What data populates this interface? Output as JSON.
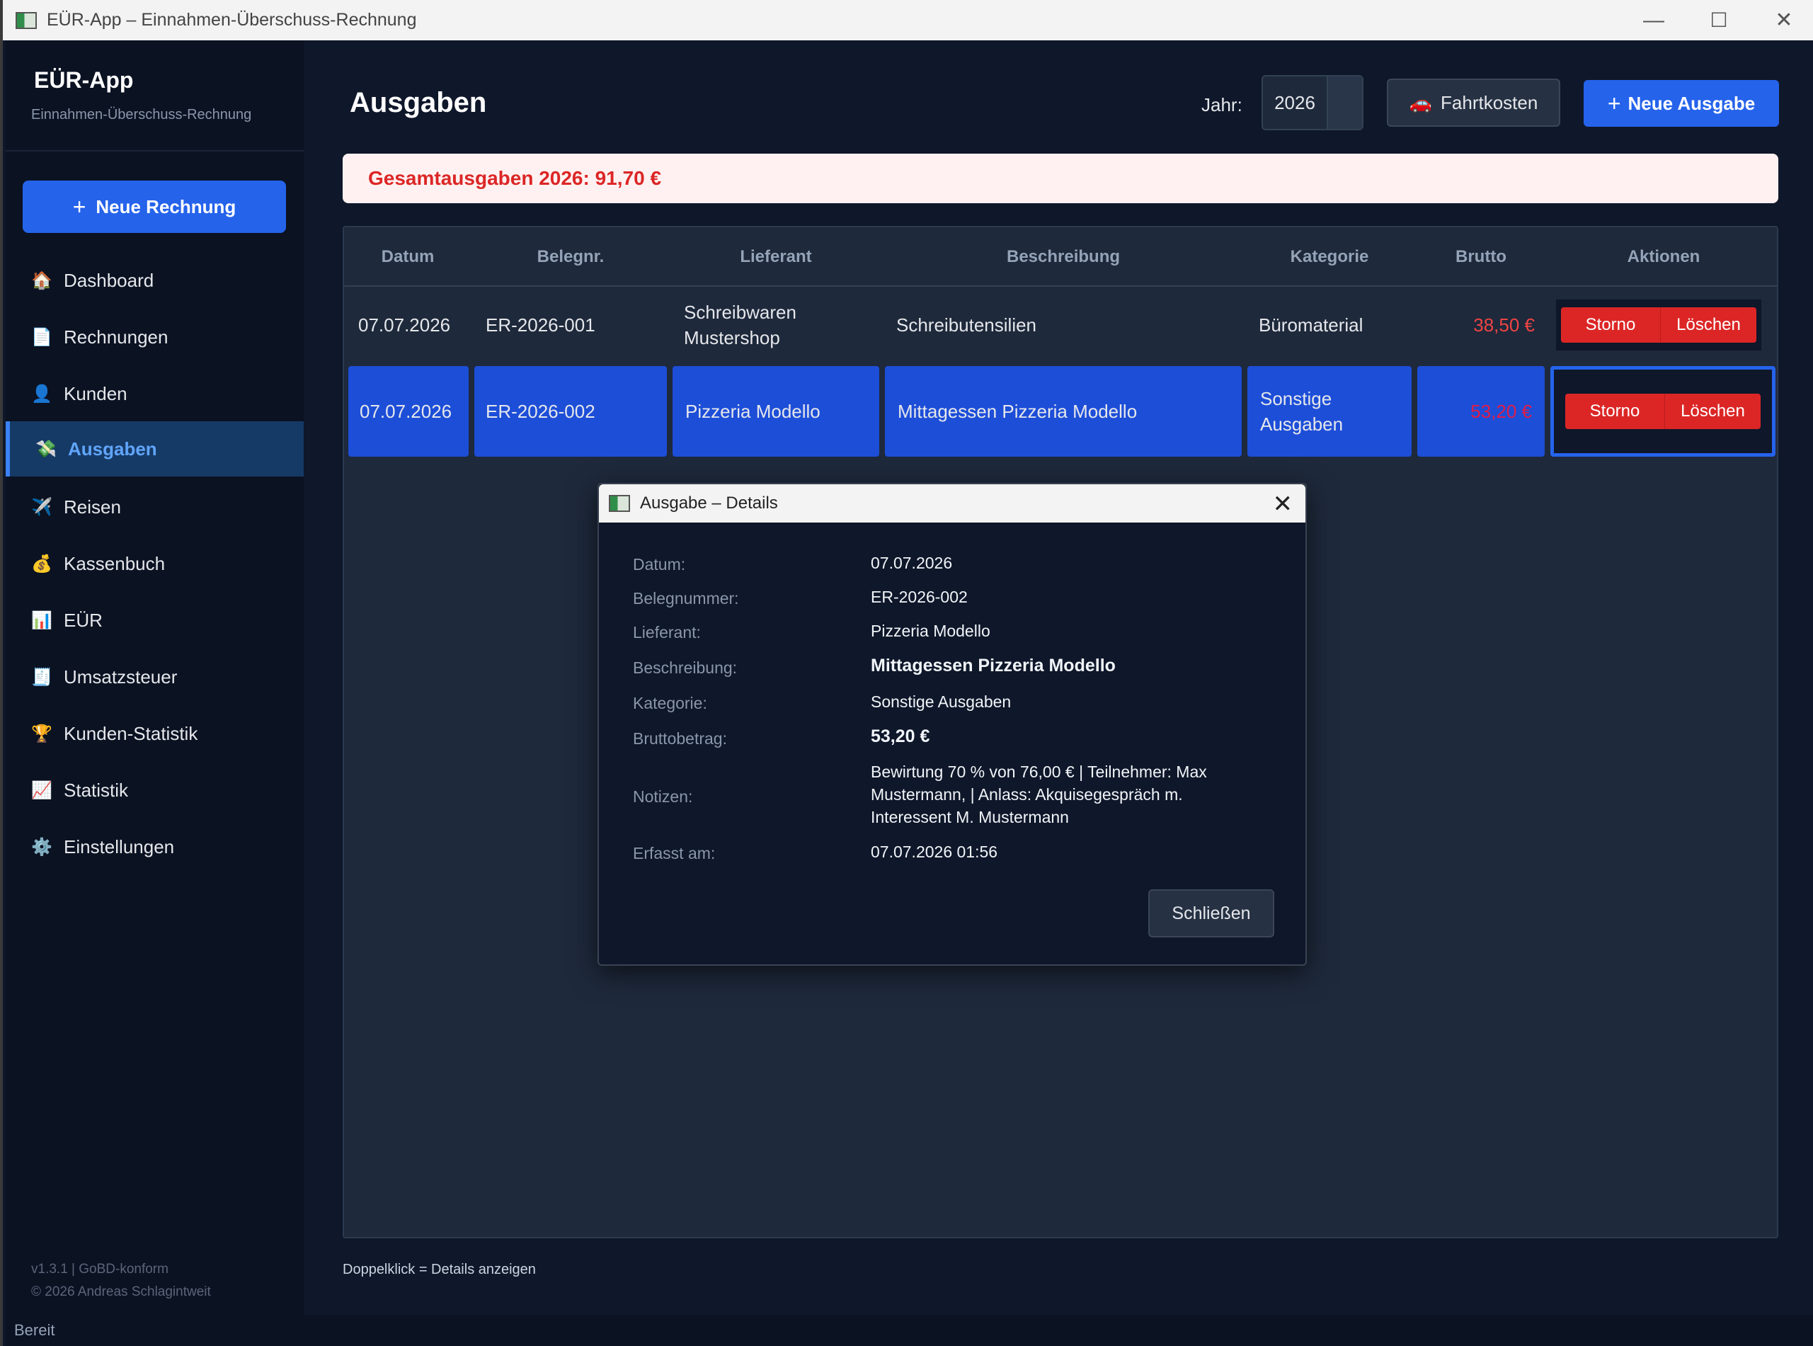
{
  "window": {
    "title": "EÜR-App – Einnahmen-Überschuss-Rechnung",
    "controls": {
      "minimize": "—",
      "maximize": "☐",
      "close": "✕"
    }
  },
  "sidebar": {
    "brand": "EÜR-App",
    "subtitle": "Einnahmen-Überschuss-Rechnung",
    "new_invoice": {
      "icon": "+",
      "label": "Neue Rechnung"
    },
    "items": [
      {
        "icon": "🏠",
        "icon_name": "house-icon",
        "label": "Dashboard"
      },
      {
        "icon": "📄",
        "icon_name": "document-icon",
        "label": "Rechnungen"
      },
      {
        "icon": "👤",
        "icon_name": "user-icon",
        "label": "Kunden"
      },
      {
        "icon": "💸",
        "icon_name": "money-wings-icon",
        "label": "Ausgaben",
        "active": true
      },
      {
        "icon": "✈️",
        "icon_name": "airplane-icon",
        "label": "Reisen"
      },
      {
        "icon": "💰",
        "icon_name": "money-bag-icon",
        "label": "Kassenbuch"
      },
      {
        "icon": "📊",
        "icon_name": "bar-chart-icon",
        "label": "EÜR"
      },
      {
        "icon": "🧾",
        "icon_name": "receipt-icon",
        "label": "Umsatzsteuer"
      },
      {
        "icon": "🏆",
        "icon_name": "trophy-icon",
        "label": "Kunden-Statistik"
      },
      {
        "icon": "📈",
        "icon_name": "line-chart-icon",
        "label": "Statistik"
      },
      {
        "icon": "⚙️",
        "icon_name": "gear-icon",
        "label": "Einstellungen"
      }
    ],
    "footer_version": "v1.3.1  |  GoBD-konform",
    "footer_copyright": "© 2026 Andreas Schlagintweit"
  },
  "main": {
    "title": "Ausgaben",
    "year_label": "Jahr:",
    "year_value": "2026",
    "fahrtkosten": {
      "icon": "🚗",
      "label": "Fahrtkosten"
    },
    "new_expense": {
      "icon": "+",
      "label": "Neue Ausgabe"
    },
    "summary": "Gesamtausgaben 2026: 91,70 €",
    "table": {
      "headers": [
        "Datum",
        "Belegnr.",
        "Lieferant",
        "Beschreibung",
        "Kategorie",
        "Brutto",
        "Aktionen"
      ],
      "rows": [
        {
          "datum": "07.07.2026",
          "beleg": "ER-2026-001",
          "lieferant": "Schreibwaren Mustershop",
          "beschreibung": "Schreibutensilien",
          "kategorie": "Büromaterial",
          "brutto": "38,50 €"
        },
        {
          "datum": "07.07.2026",
          "beleg": "ER-2026-002",
          "lieferant": "Pizzeria Modello",
          "beschreibung": "Mittagessen Pizzeria Modello",
          "kategorie": "Sonstige Ausgaben",
          "brutto": "53,20 €",
          "selected": true
        }
      ],
      "action_storno": "Storno",
      "action_delete": "Löschen"
    },
    "hint": "Doppelklick = Details anzeigen"
  },
  "status": "Bereit",
  "dialog": {
    "title": "Ausgabe – Details",
    "fields": [
      {
        "label": "Datum:",
        "value": "07.07.2026"
      },
      {
        "label": "Belegnummer:",
        "value": "ER-2026-002"
      },
      {
        "label": "Lieferant:",
        "value": "Pizzeria Modello"
      },
      {
        "label": "Beschreibung:",
        "value": "Mittagessen Pizzeria Modello"
      },
      {
        "label": "Kategorie:",
        "value": "Sonstige Ausgaben"
      },
      {
        "label": "Bruttobetrag:",
        "value": "53,20 €"
      },
      {
        "label": "Notizen:",
        "value": "Bewirtung 70 % von 76,00 € | Teilnehmer: Max Mustermann, | Anlass: Akquisegespräch m. Interessent M. Mustermann"
      },
      {
        "label": "Erfasst am:",
        "value": "07.07.2026 01:56"
      }
    ],
    "close_button": "Schließen"
  }
}
